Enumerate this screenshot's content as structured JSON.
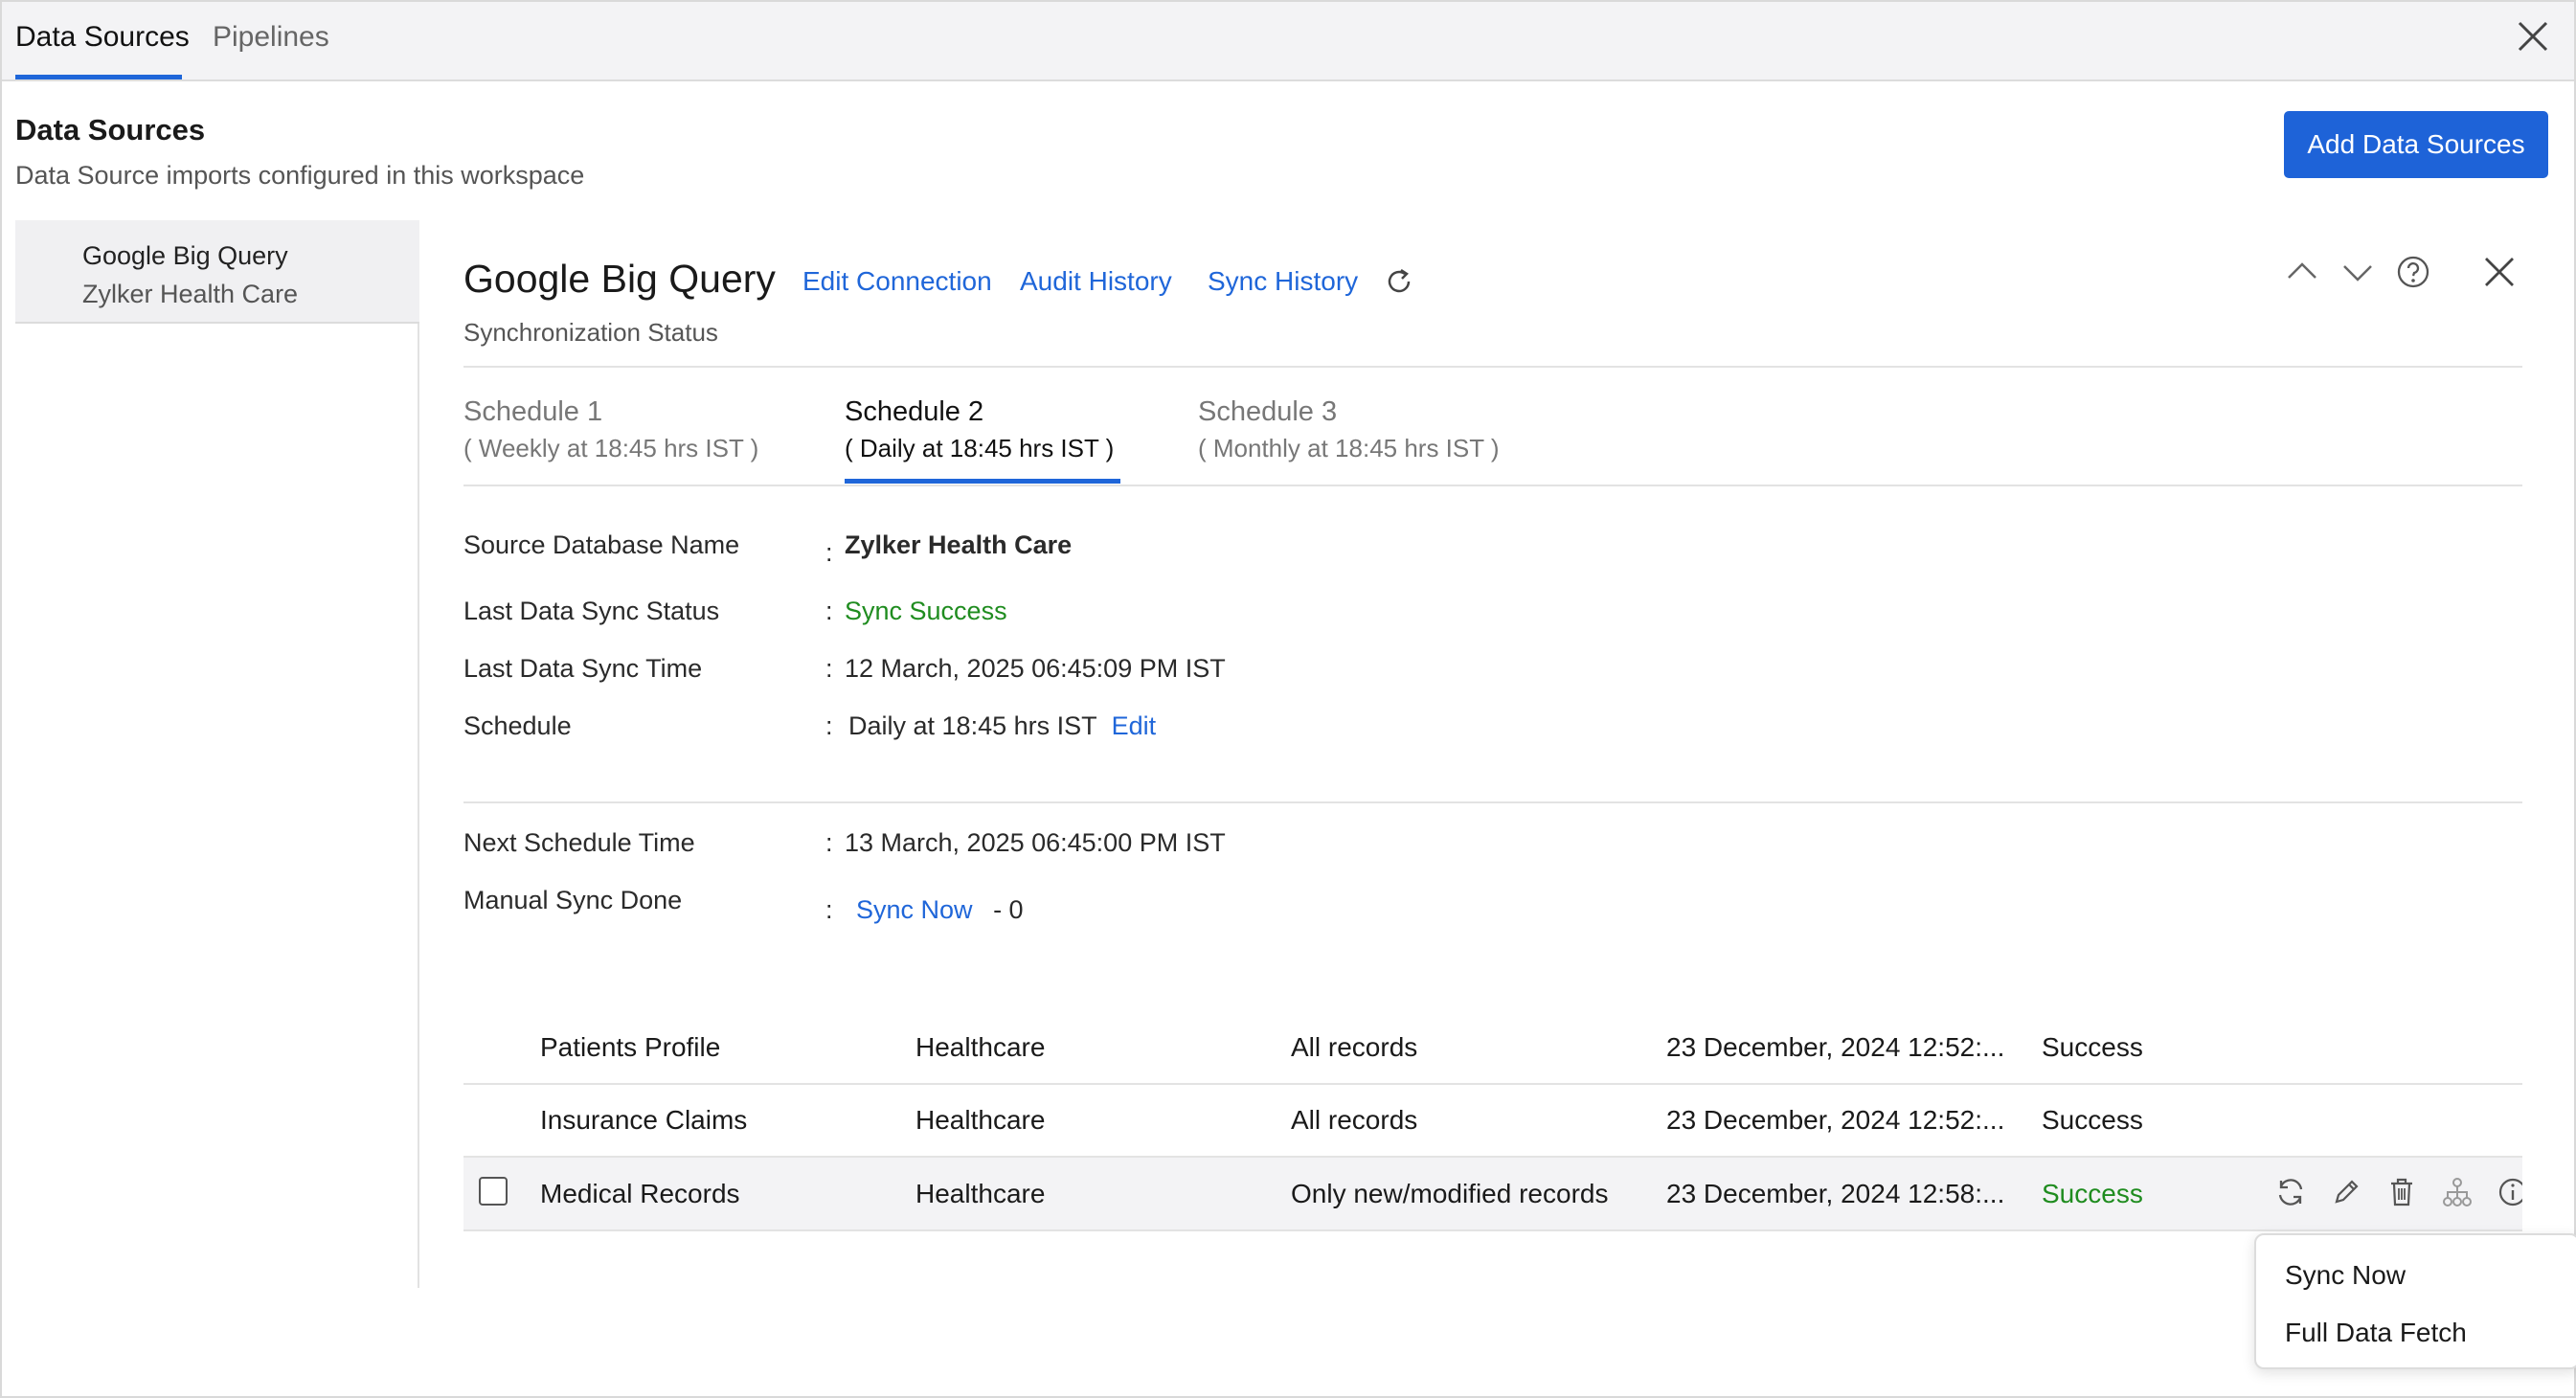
{
  "tabs": [
    {
      "label": "Data Sources"
    },
    {
      "label": "Pipelines"
    }
  ],
  "header": {
    "title": "Data Sources",
    "subtitle": "Data Source imports configured in this workspace",
    "add_button": "Add Data Sources"
  },
  "sidebar": {
    "items": [
      {
        "name": "Google Big Query",
        "workspace": "Zylker Health Care"
      }
    ]
  },
  "detail": {
    "title": "Google Big Query",
    "links": {
      "edit_connection": "Edit Connection",
      "audit_history": "Audit History",
      "sync_history": "Sync History"
    },
    "subtitle": "Synchronization Status",
    "schedules": [
      {
        "name": "Schedule 1",
        "desc": "( Weekly at 18:45 hrs IST )"
      },
      {
        "name": "Schedule 2",
        "desc": "( Daily at 18:45 hrs IST )"
      },
      {
        "name": "Schedule 3",
        "desc": "( Monthly at 18:45 hrs IST )"
      }
    ],
    "fields": {
      "source_db_label": "Source Database Name",
      "source_db_value": "Zylker Health Care",
      "last_status_label": "Last Data Sync Status",
      "last_status_value": "Sync Success",
      "last_time_label": "Last Data Sync Time",
      "last_time_value": "12 March, 2025 06:45:09 PM IST",
      "schedule_label": "Schedule",
      "schedule_value": "Daily at 18:45 hrs IST",
      "schedule_edit": "Edit",
      "next_label": "Next Schedule Time",
      "next_value": "13 March, 2025 06:45:00 PM IST",
      "manual_label": "Manual Sync Done",
      "manual_link": "Sync Now",
      "manual_count": "- 0",
      "colon": ":"
    }
  },
  "table": {
    "rows": [
      {
        "name": "Patients Profile",
        "category": "Healthcare",
        "fetch": "All records",
        "time": "23 December, 2024 12:52:...",
        "status": "Success"
      },
      {
        "name": "Insurance Claims",
        "category": "Healthcare",
        "fetch": "All records",
        "time": "23 December, 2024 12:52:...",
        "status": "Success"
      },
      {
        "name": "Medical Records",
        "category": "Healthcare",
        "fetch": "Only new/modified records",
        "time": "23 December, 2024 12:58:...",
        "status": "Success"
      }
    ]
  },
  "dropdown": {
    "items": [
      "Sync Now",
      "Full Data Fetch"
    ]
  },
  "colors": {
    "accent": "#1f66d9",
    "button": "#1e63d8",
    "success": "#1f8c1f"
  }
}
